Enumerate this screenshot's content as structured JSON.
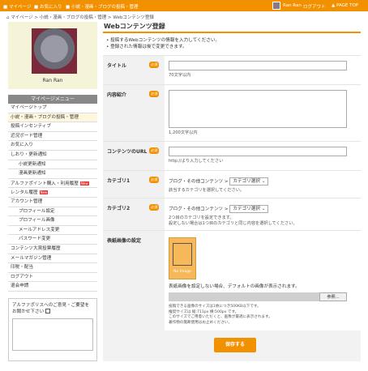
{
  "topbar": {
    "links": [
      "マイページ",
      "お気に入り",
      "小説・漫画・ブログの投稿・管理"
    ],
    "user_name": "Ran Ran",
    "logout": "ログアウト",
    "page_top": "PAGE TOP"
  },
  "breadcrumb": "マイページ > 小説・漫画・ブログの投稿・管理 > Webコンテンツ登録",
  "profile": {
    "name": "Ran Ran"
  },
  "menu": {
    "title": "マイページメニュー",
    "items": [
      {
        "label": "マイページトップ",
        "sub": false
      },
      {
        "label": "小説・漫画・ブログの投稿・管理",
        "sub": false,
        "active": true
      },
      {
        "label": "投稿インセンティブ",
        "sub": false
      },
      {
        "label": "近況ボード管理",
        "sub": false
      },
      {
        "label": "お気に入り",
        "sub": false
      },
      {
        "label": "しおり・更新通知",
        "sub": false
      },
      {
        "label": "小説更新通知",
        "sub": true
      },
      {
        "label": "漫画更新通知",
        "sub": true
      },
      {
        "label": "アルファポイント購入・利用履歴",
        "sub": false,
        "badge": "New"
      },
      {
        "label": "レンタル履歴",
        "sub": false,
        "badge": "New"
      },
      {
        "label": "アカウント管理",
        "sub": false
      },
      {
        "label": "プロフィール設定",
        "sub": true
      },
      {
        "label": "プロフィール画像",
        "sub": true
      },
      {
        "label": "メールアドレス変更",
        "sub": true
      },
      {
        "label": "パスワード変更",
        "sub": true
      },
      {
        "label": "コンテンツ大賞投票履歴",
        "sub": false
      },
      {
        "label": "メールマガジン管理",
        "sub": false
      },
      {
        "label": "印税・配当",
        "sub": false
      },
      {
        "label": "ログアウト",
        "sub": false
      },
      {
        "label": "退会申請",
        "sub": false
      }
    ]
  },
  "feedback": {
    "text": "アルファポリスへのご意見・ご要望をお聞かせ下さい"
  },
  "main": {
    "title": "Webコンテンツ登録",
    "notes": [
      "投稿するWebコンテンツの情報を入力してください。",
      "登録された情報は後で変更できます。"
    ],
    "required_label": "必須",
    "fields": {
      "title": {
        "label": "タイトル",
        "hint": "70文字以内"
      },
      "intro": {
        "label": "内容紹介",
        "hint": "1,200文字以内"
      },
      "url": {
        "label": "コンテンツのURL",
        "hint": "http://より入力してください"
      },
      "cat1": {
        "label": "カテゴリ1",
        "primary": "ブログ・その他コンテンツ",
        "secondary": "カテゴリ選択",
        "hint": "該当するカテゴリを選択してください。"
      },
      "cat2": {
        "label": "カテゴリ2",
        "primary": "ブログ・その他コンテンツ",
        "secondary": "カテゴリ選択",
        "hint1": "2つ目のカテゴリを設定できます。",
        "hint2": "設定しない場合は1つ目のカテゴリと同じ内容を選択してください。"
      },
      "cover": {
        "label": "表紙画像の設定",
        "no_image": "No Image",
        "note": "表紙画像を設定しない場合、デフォルトの画像が表示されます。",
        "browse": "参照...",
        "hint1": "投稿できる画像のサイズは1枚につき500KB以下です。",
        "hint2": "推奨サイズは 縦:711px 横:500px です。",
        "hint3": "このサイズでご用意いただくと、画像が最適に表示されます。",
        "hint4": "著作物の無断使用はお止めください。"
      }
    },
    "submit": "保存する"
  },
  "colors": {
    "accent": "#f29100"
  }
}
